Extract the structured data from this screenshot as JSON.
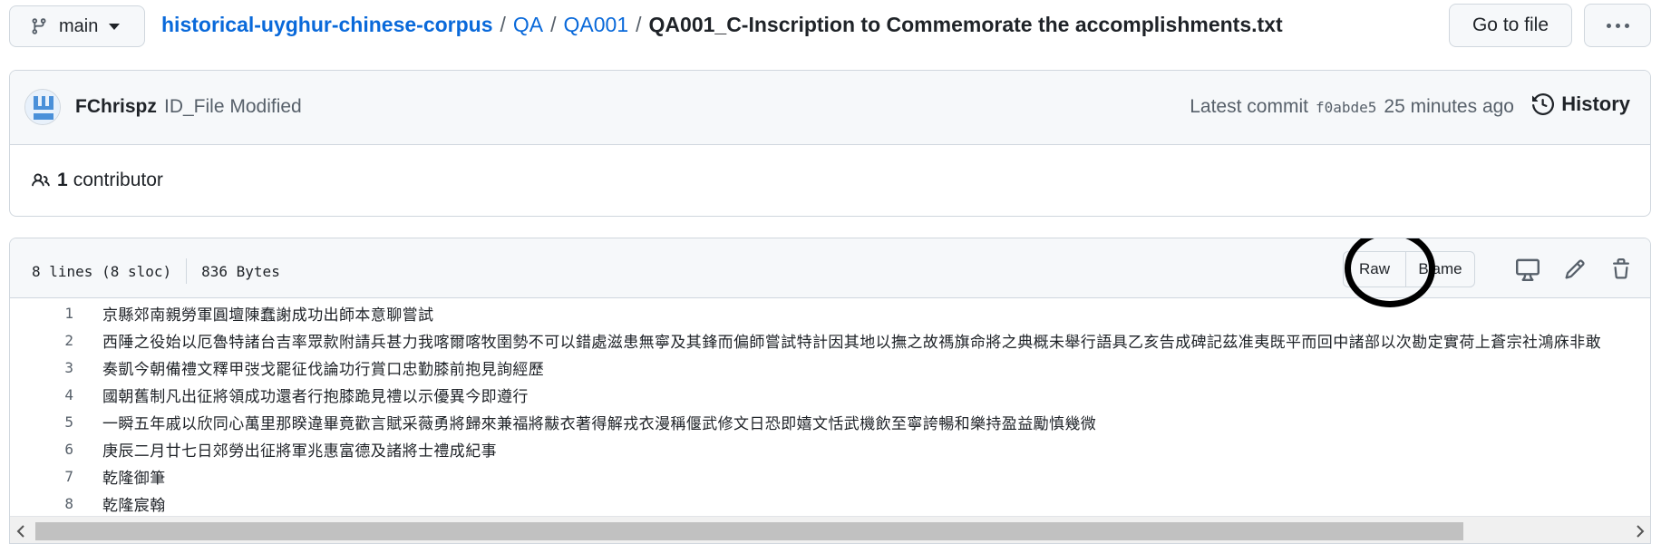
{
  "topbar": {
    "branch": "main",
    "breadcrumb": {
      "repo": "historical-uyghur-chinese-corpus",
      "dir1": "QA",
      "dir2": "QA001",
      "file": "QA001_C-Inscription to Commemorate the accomplishments.txt",
      "separator": "/"
    },
    "goto_file": "Go to file"
  },
  "commit": {
    "author": "FChrispz",
    "message": "ID_File Modified",
    "latest_label": "Latest commit",
    "sha": "f0abde5",
    "time": "25 minutes ago",
    "history_label": "History"
  },
  "contributors": {
    "count": "1",
    "label": "contributor"
  },
  "file": {
    "lines_info": "8 lines (8 sloc)",
    "size": "836 Bytes",
    "raw_label": "Raw",
    "blame_label": "Blame",
    "lines": [
      {
        "n": "1",
        "text": "京縣郊南親勞軍圓壇陳蠢謝成功出師本意聊嘗試"
      },
      {
        "n": "2",
        "text": "西陲之役始以厄魯特諸台吉率眾款附請兵甚力我喀爾喀牧圉勢不可以錯處滋患無寧及其鋒而偏師嘗試特計因其地以撫之故禡旗命將之典概未舉行語具乙亥告成碑記茲准夷既平而回中諸部以次勘定實荷上蒼宗社鴻庥非敢"
      },
      {
        "n": "3",
        "text": "奏凱今朝備禮文釋甲弢戈罷征伐論功行賞口忠勤膝前抱見詢經歷"
      },
      {
        "n": "4",
        "text": "國朝舊制凡出征將領成功還者行抱膝跪見禮以示優異今即遵行"
      },
      {
        "n": "5",
        "text": "一瞬五年戚以欣同心萬里那睽違畢竟歡言賦采薇勇將歸來兼福將黻衣著得解戎衣漫稱偃武修文日恐即嬉文恬武機飲至寧誇暢和樂持盈益勵慎幾微"
      },
      {
        "n": "6",
        "text": "庚辰二月廿七日郊勞出征將軍兆惠富德及諸將士禮成紀事"
      },
      {
        "n": "7",
        "text": "乾隆御筆"
      },
      {
        "n": "8",
        "text": "乾隆宸翰"
      }
    ]
  },
  "colors": {
    "link": "#0969da",
    "border": "#d0d7de",
    "header_bg": "#f6f8fa",
    "annotation": "#000000"
  },
  "icons": [
    "git-branch-icon",
    "caret-down-icon",
    "kebab-horizontal-icon",
    "avatar",
    "history-icon",
    "people-icon",
    "desktop-icon",
    "pencil-icon",
    "trash-icon",
    "scroll-left-icon",
    "scroll-right-icon"
  ]
}
